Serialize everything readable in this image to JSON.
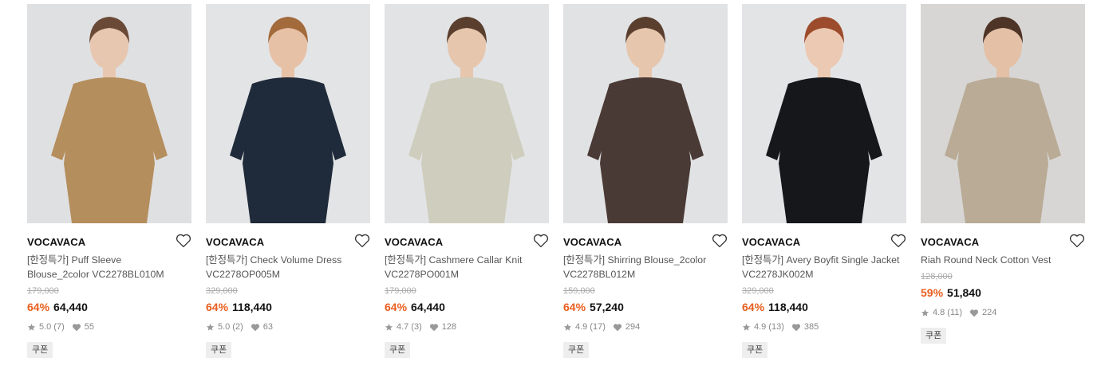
{
  "products": [
    {
      "brand": "VOCAVACA",
      "name_line1": "[한정특가] Puff Sleeve",
      "name_line2": "Blouse_2color VC2278BL010M",
      "original_price": "179,000",
      "discount": "64%",
      "price": "64,440",
      "rating": "5.0",
      "review_count": "(7)",
      "likes": "55",
      "coupon": "쿠폰",
      "image_colors": {
        "bg": "#dfe0e2",
        "garment": "#b58e5d",
        "skin": "#e8c7b0",
        "hair": "#6a4a36"
      }
    },
    {
      "brand": "VOCAVACA",
      "name_line1": "[한정특가] Check Volume Dress",
      "name_line2": "VC2278OP005M",
      "original_price": "329,000",
      "discount": "64%",
      "price": "118,440",
      "rating": "5.0",
      "review_count": "(2)",
      "likes": "63",
      "coupon": "쿠폰",
      "image_colors": {
        "bg": "#e3e4e6",
        "garment": "#1f2a3a",
        "skin": "#e6c1a6",
        "hair": "#a36a3c"
      }
    },
    {
      "brand": "VOCAVACA",
      "name_line1": "[한정특가] Cashmere Callar Knit",
      "name_line2": "VC2278PO001M",
      "original_price": "179,000",
      "discount": "64%",
      "price": "64,440",
      "rating": "4.7",
      "review_count": "(3)",
      "likes": "128",
      "coupon": "쿠폰",
      "image_colors": {
        "bg": "#e2e3e5",
        "garment": "#cfcdbd",
        "skin": "#e6c6ad",
        "hair": "#5a3f2e"
      }
    },
    {
      "brand": "VOCAVACA",
      "name_line1": "[한정특가] Shirring Blouse_2color",
      "name_line2": "VC2278BL012M",
      "original_price": "159,000",
      "discount": "64%",
      "price": "57,240",
      "rating": "4.9",
      "review_count": "(17)",
      "likes": "294",
      "coupon": "쿠폰",
      "image_colors": {
        "bg": "#e1e2e4",
        "garment": "#4a3a35",
        "skin": "#e6c6ad",
        "hair": "#5a3f2e"
      }
    },
    {
      "brand": "VOCAVACA",
      "name_line1": "[한정특가] Avery Boyfit Single Jacket",
      "name_line2": "VC2278JK002M",
      "original_price": "329,000",
      "discount": "64%",
      "price": "118,440",
      "rating": "4.9",
      "review_count": "(13)",
      "likes": "385",
      "coupon": "쿠폰",
      "image_colors": {
        "bg": "#e3e4e6",
        "garment": "#15171b",
        "skin": "#ecc9b2",
        "hair": "#9c4c2c"
      }
    },
    {
      "brand": "VOCAVACA",
      "name_line1": "Riah Round Neck Cotton Vest",
      "name_line2": "",
      "original_price": "128,000",
      "discount": "59%",
      "price": "51,840",
      "rating": "4.8",
      "review_count": "(11)",
      "likes": "224",
      "coupon": "쿠폰",
      "image_colors": {
        "bg": "#d7d6d4",
        "garment": "#b9ab96",
        "skin": "#e3c0a6",
        "hair": "#4e3426"
      }
    }
  ],
  "accent_color": "#e95e1e",
  "icons": {
    "wishlist": "heart-outline-icon",
    "rating": "star-icon",
    "likes": "heart-filled-icon"
  }
}
